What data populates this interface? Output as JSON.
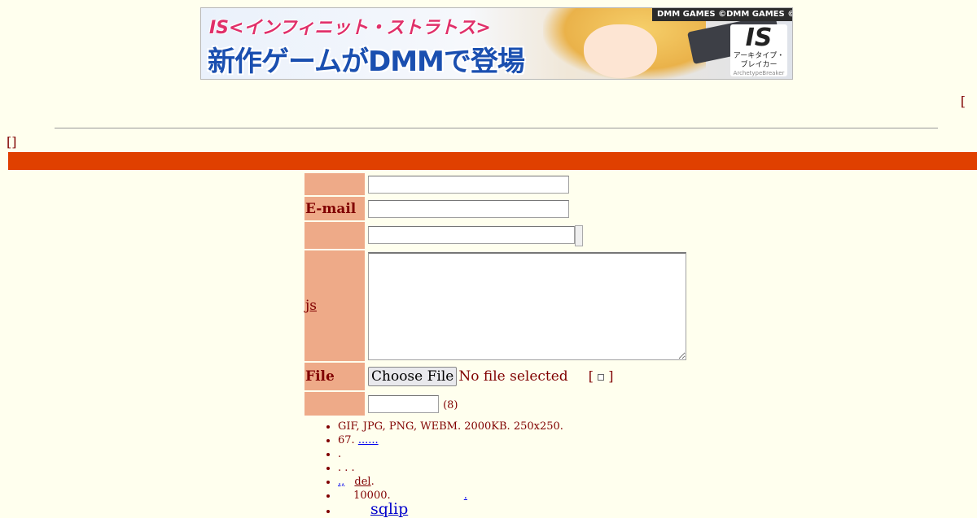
{
  "banner": {
    "brand_top": "IS<インフィニット・ストラトス>",
    "headline": "新作ゲームがDMMで登場",
    "dmm_bar": "DMM GAMES ©DMM GAMES ©I,O/I",
    "logo_mark": "IS",
    "logo_sub": "アーキタイプ・ブレイカー",
    "logo_sub2": "ArchetypeBreaker"
  },
  "top_link": {
    "open": "["
  },
  "bracket_link": "[]",
  "form": {
    "email_label": "E-mail",
    "js_label": "js",
    "file_label": "File",
    "file_button": "Choose File",
    "file_status": "No file selected",
    "file_bracket_open": "[",
    "file_bracket_close": "]",
    "captcha_hint": "(8)"
  },
  "notes": {
    "line1": "GIF, JPG, PNG, WEBM. 2000KB. 250x250.",
    "line2_text": "67.",
    "line2_link": "......",
    "line3": ".",
    "line4": ". . .",
    "line5_link": ".,",
    "line5_del": "del",
    "line5_end": ".",
    "line6_text": "10000.",
    "line6_link": ".",
    "line7_link": "sqlip"
  },
  "colors": {
    "background": "#ffffee",
    "text": "#800000",
    "bar": "#e04000",
    "label_bg": "#eeaa88"
  }
}
